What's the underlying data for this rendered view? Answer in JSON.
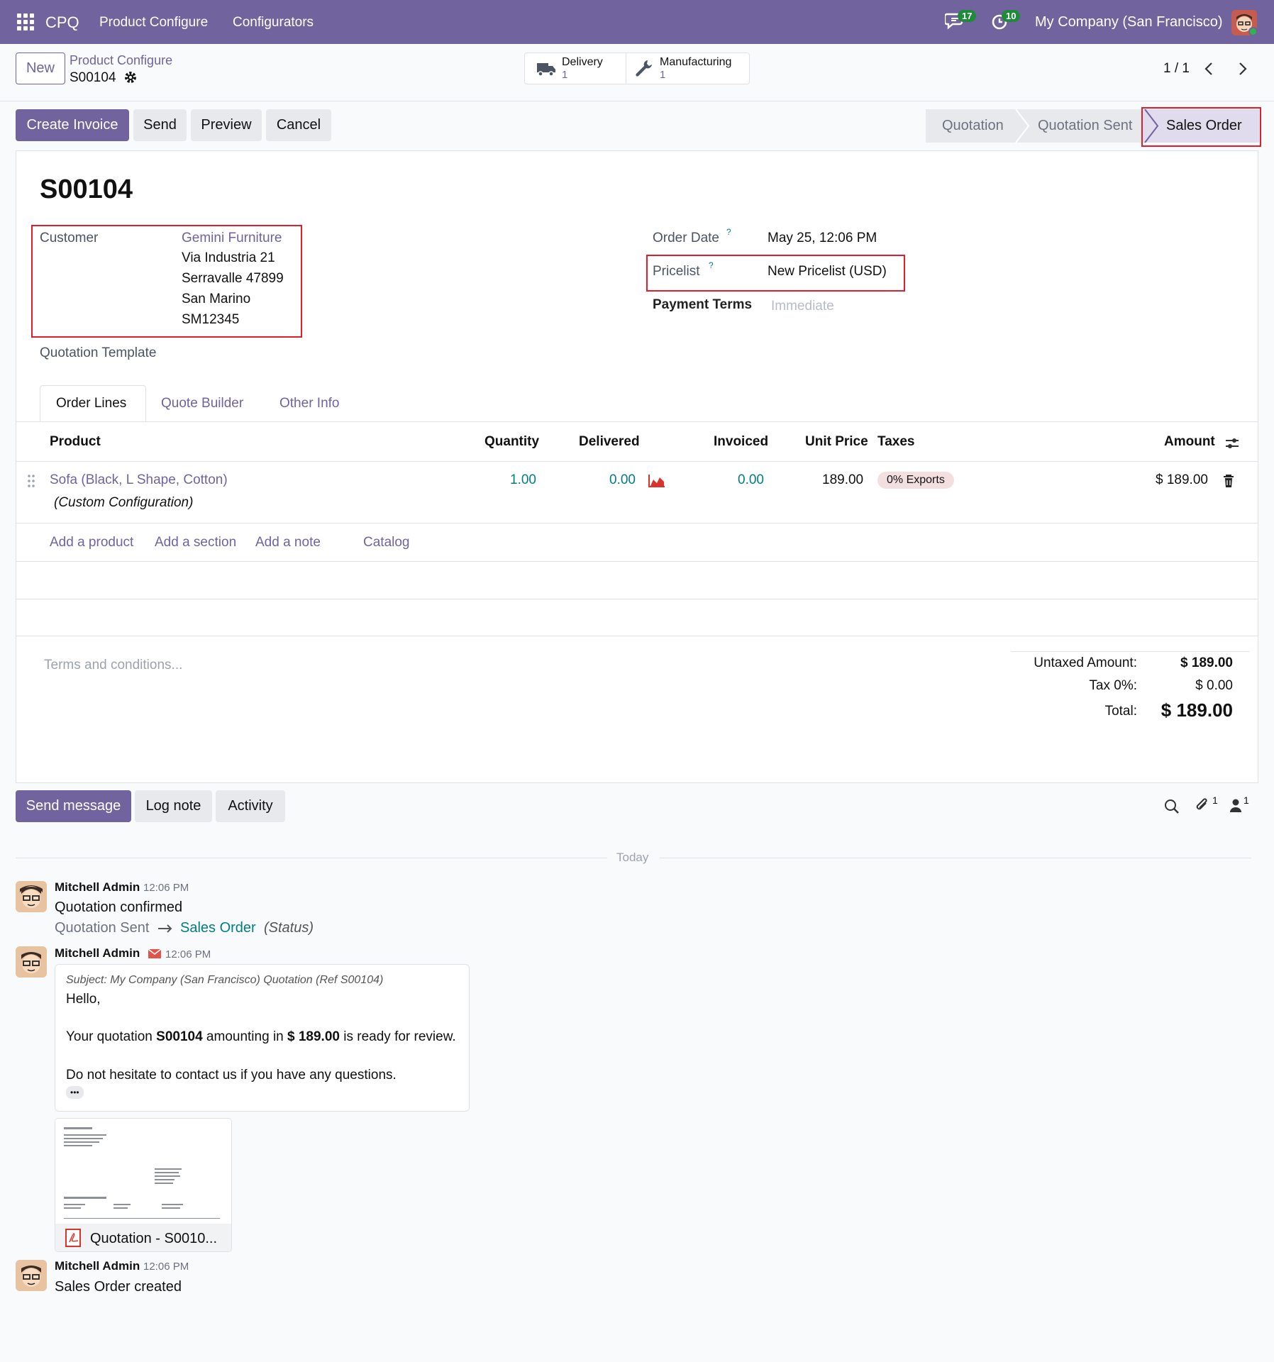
{
  "topbar": {
    "brand": "CPQ",
    "menu": [
      "Product Configure",
      "Configurators"
    ],
    "messages_count": "17",
    "activities_count": "10",
    "company": "My Company (San Francisco)"
  },
  "control": {
    "new_label": "New",
    "breadcrumb_parent": "Product Configure",
    "record_name": "S00104",
    "smart_buttons": [
      {
        "label": "Delivery",
        "count": "1"
      },
      {
        "label": "Manufacturing",
        "count": "1"
      }
    ],
    "pager": "1 / 1"
  },
  "actions": {
    "create_invoice": "Create Invoice",
    "send": "Send",
    "preview": "Preview",
    "cancel": "Cancel"
  },
  "statusbar": [
    "Quotation",
    "Quotation Sent",
    "Sales Order"
  ],
  "form": {
    "title": "S00104",
    "customer_label": "Customer",
    "customer_name": "Gemini Furniture",
    "customer_address": [
      "Via Industria 21",
      "Serravalle 47899",
      "San Marino",
      "SM12345"
    ],
    "quotation_template_label": "Quotation Template",
    "order_date_label": "Order Date",
    "order_date": "May 25, 12:06 PM",
    "pricelist_label": "Pricelist",
    "pricelist": "New Pricelist (USD)",
    "payment_terms_label": "Payment Terms",
    "payment_terms_placeholder": "Immediate",
    "help_mark": "?"
  },
  "tabs": [
    "Order Lines",
    "Quote Builder",
    "Other Info"
  ],
  "lines": {
    "headers": {
      "product": "Product",
      "quantity": "Quantity",
      "delivered": "Delivered",
      "invoiced": "Invoiced",
      "unit_price": "Unit Price",
      "taxes": "Taxes",
      "amount": "Amount"
    },
    "rows": [
      {
        "product": "Sofa (Black, L Shape, Cotton)",
        "description": "(Custom Configuration)",
        "quantity": "1.00",
        "delivered": "0.00",
        "invoiced": "0.00",
        "unit_price": "189.00",
        "tax": "0% Exports",
        "amount": "$ 189.00"
      }
    ],
    "add_links": [
      "Add a product",
      "Add a section",
      "Add a note",
      "Catalog"
    ]
  },
  "totals": {
    "terms_placeholder": "Terms and conditions...",
    "untaxed_label": "Untaxed Amount:",
    "untaxed": "$ 189.00",
    "tax_label": "Tax 0%:",
    "tax": "$ 0.00",
    "total_label": "Total:",
    "total": "$ 189.00"
  },
  "chatter": {
    "send_message": "Send message",
    "log_note": "Log note",
    "activity": "Activity",
    "attachments_count": "1",
    "followers_count": "1",
    "today": "Today",
    "messages": [
      {
        "author": "Mitchell Admin",
        "time": "12:06 PM",
        "body": "Quotation confirmed",
        "track_old": "Quotation Sent",
        "track_new": "Sales Order",
        "track_field": "(Status)"
      },
      {
        "author": "Mitchell Admin",
        "time": "12:06 PM",
        "subject": "Subject: My Company (San Francisco) Quotation (Ref S00104)",
        "hello": "Hello,",
        "line_pre": "Your quotation ",
        "line_ref": "S00104",
        "line_mid": " amounting in ",
        "line_amount": "$ 189.00",
        "line_post": " is ready for review.",
        "closing": "Do not hesitate to contact us if you have any questions.",
        "more": "•••",
        "attachment": "Quotation - S0010..."
      },
      {
        "author": "Mitchell Admin",
        "time": "12:06 PM",
        "body": "Sales Order created"
      }
    ]
  },
  "colors": {
    "brand": "#71639e",
    "teal": "#017e84",
    "highlight": "#e11d2a",
    "badge": "#1f8a3a"
  }
}
